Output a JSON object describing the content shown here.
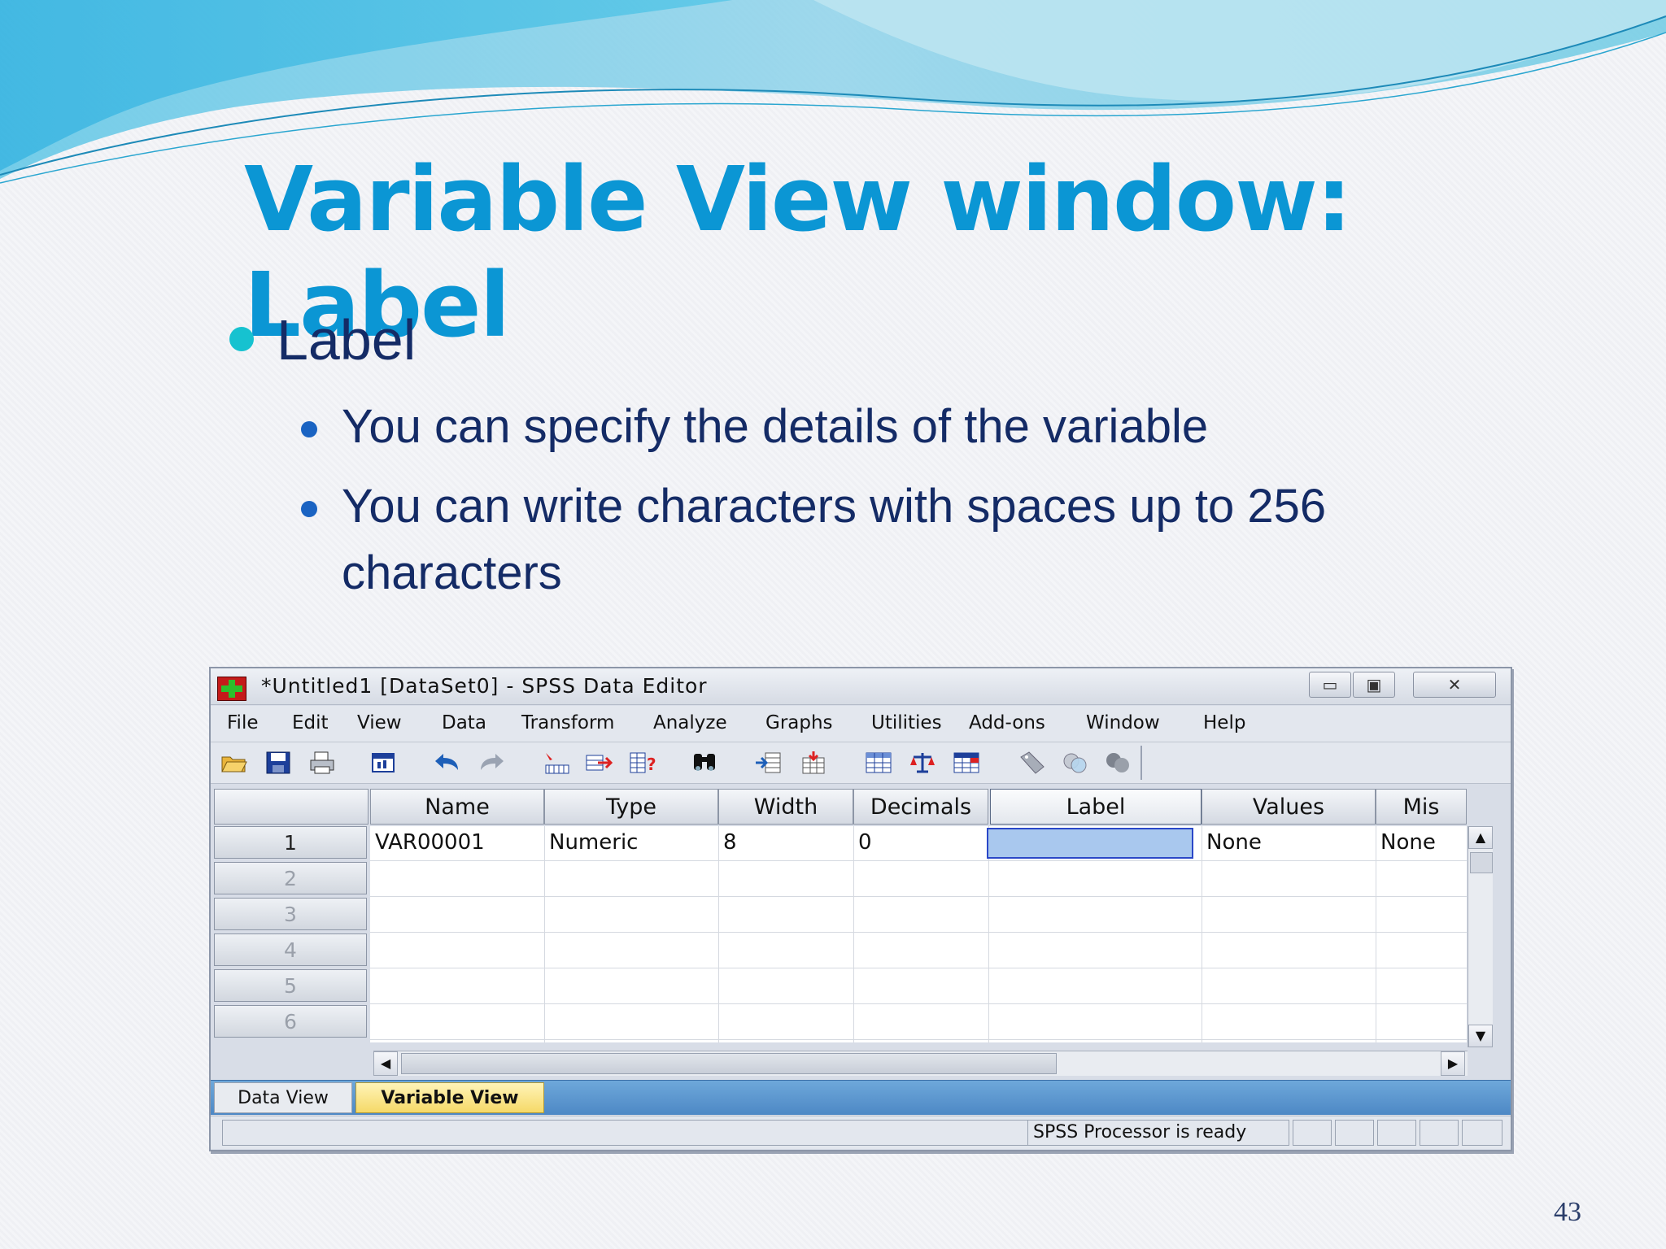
{
  "slide": {
    "title": "Variable View window: Label",
    "bullet": "Label",
    "sub_bullets": [
      "You can specify the details of the variable",
      "You can write characters with spaces up to 256",
      "characters"
    ],
    "page_number": "43"
  },
  "window": {
    "title": "*Untitled1 [DataSet0] - SPSS Data Editor",
    "buttons": {
      "minimize": "▭",
      "maximize": "▣",
      "close": "✕"
    },
    "menu": [
      "File",
      "Edit",
      "View",
      "Data",
      "Transform",
      "Analyze",
      "Graphs",
      "Utilities",
      "Add-ons",
      "Window",
      "Help"
    ],
    "toolbar_icons": [
      "open-icon",
      "save-icon",
      "print-icon",
      "dialog-recall-icon",
      "undo-icon",
      "redo-icon",
      "goto-case-icon",
      "goto-variable-icon",
      "variables-icon",
      "find-icon",
      "insert-cases-icon",
      "insert-variable-icon",
      "split-file-icon",
      "weight-cases-icon",
      "select-cases-icon",
      "value-labels-icon",
      "use-sets-icon",
      "show-all-variables-icon"
    ],
    "columns": [
      "Name",
      "Type",
      "Width",
      "Decimals",
      "Label",
      "Values",
      "Mis"
    ],
    "rows": [
      {
        "num": "1",
        "cells": [
          "VAR00001",
          "Numeric",
          "8",
          "0",
          "",
          "None",
          "None"
        ]
      },
      {
        "num": "2",
        "cells": []
      },
      {
        "num": "3",
        "cells": []
      },
      {
        "num": "4",
        "cells": []
      },
      {
        "num": "5",
        "cells": []
      },
      {
        "num": "6",
        "cells": []
      }
    ],
    "tabs": {
      "data_view": "Data View",
      "variable_view": "Variable View"
    },
    "status": "SPSS  Processor is ready"
  },
  "colors": {
    "title": "#0b96d4",
    "body_text": "#142b66",
    "bullet_l1": "#16c2d0",
    "bullet_l2": "#1a63c2",
    "selected_cell": "#a9c8ee",
    "active_tab": "#f5d968"
  }
}
